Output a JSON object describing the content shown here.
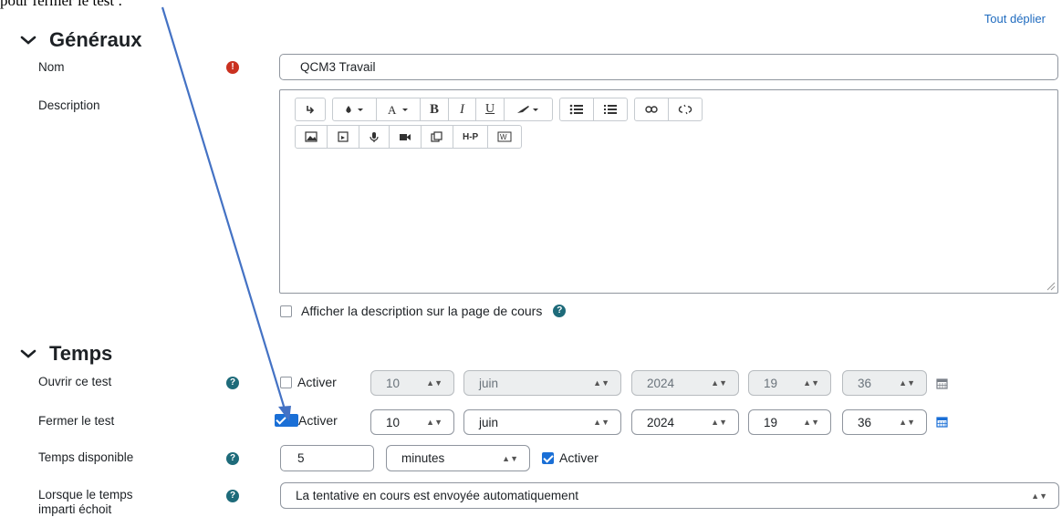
{
  "annotation": {
    "text": "pour fermer le test :"
  },
  "expand_all_label": "Tout déplier",
  "sections": {
    "generaux": {
      "title": "Généraux"
    },
    "temps": {
      "title": "Temps"
    }
  },
  "fields": {
    "nom": {
      "label": "Nom",
      "value": "QCM3 Travail"
    },
    "description": {
      "label": "Description",
      "value": ""
    },
    "show_description": {
      "label": "Afficher la description sur la page de cours",
      "checked": false
    },
    "ouvrir": {
      "label": "Ouvrir ce test",
      "enable_label": "Activer",
      "enabled": false,
      "day": "10",
      "month": "juin",
      "year": "2024",
      "hour": "19",
      "minute": "36"
    },
    "fermer": {
      "label": "Fermer le test",
      "enable_label": "Activer",
      "enabled": true,
      "day": "10",
      "month": "juin",
      "year": "2024",
      "hour": "19",
      "minute": "36"
    },
    "temps_dispo": {
      "label": "Temps disponible",
      "value": "5",
      "unit": "minutes",
      "enable_label": "Activer",
      "enabled": true
    },
    "lorsque": {
      "label_line1": "Lorsque le temps",
      "label_line2": "imparti échoit",
      "value": "La tentative en cours est envoyée automatiquement"
    }
  },
  "editor_toolbar": {
    "row1": [
      [
        "undo-icon"
      ],
      [
        "font-color-icon",
        "text-size-icon",
        "bold-icon",
        "italic-icon",
        "underline-icon",
        "paint-icon"
      ],
      [
        "bullet-list-icon",
        "numbered-list-icon"
      ],
      [
        "link-icon",
        "unlink-icon"
      ]
    ],
    "row2": [
      [
        "image-icon",
        "media-icon",
        "record-audio-icon",
        "record-video-icon",
        "manage-files-icon",
        "h5p-icon",
        "word-import-icon"
      ]
    ],
    "labels": {
      "bold": "B",
      "italic": "I",
      "underline": "U",
      "h5p": "H-P"
    }
  },
  "colors": {
    "accent": "#1a6fd6",
    "arrow": "#4472c4",
    "required": "#ca3120",
    "help": "#1e6b7a",
    "link": "#1f6bbf"
  }
}
